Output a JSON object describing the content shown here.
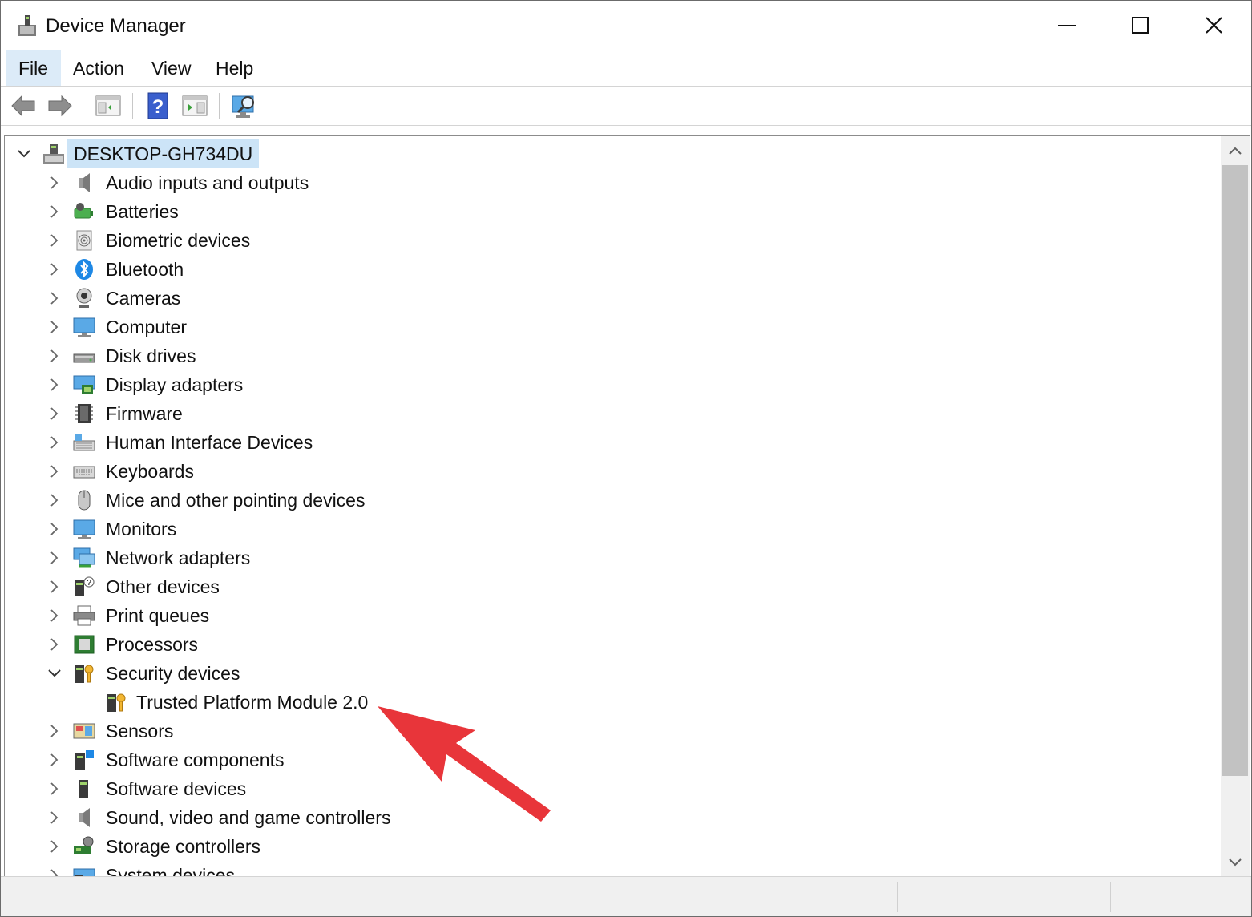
{
  "window": {
    "title": "Device Manager"
  },
  "menu": {
    "file": "File",
    "action": "Action",
    "view": "View",
    "help": "Help"
  },
  "toolbar": {
    "buttons": [
      "back-arrow-icon",
      "forward-arrow-icon",
      "show-hide-console-tree-icon",
      "help-icon",
      "action-pane-icon",
      "scan-hardware-changes-icon"
    ]
  },
  "tree": {
    "root": {
      "label": "DESKTOP-GH734DU",
      "icon": "computer-tower-icon",
      "expanded": true
    },
    "categories": [
      {
        "label": "Audio inputs and outputs",
        "icon": "speaker-icon",
        "expanded": false
      },
      {
        "label": "Batteries",
        "icon": "battery-icon",
        "expanded": false
      },
      {
        "label": "Biometric devices",
        "icon": "fingerprint-icon",
        "expanded": false
      },
      {
        "label": "Bluetooth",
        "icon": "bluetooth-icon",
        "expanded": false
      },
      {
        "label": "Cameras",
        "icon": "webcam-icon",
        "expanded": false
      },
      {
        "label": "Computer",
        "icon": "monitor-icon",
        "expanded": false
      },
      {
        "label": "Disk drives",
        "icon": "disk-drive-icon",
        "expanded": false
      },
      {
        "label": "Display adapters",
        "icon": "display-adapter-icon",
        "expanded": false
      },
      {
        "label": "Firmware",
        "icon": "chip-icon",
        "expanded": false
      },
      {
        "label": "Human Interface Devices",
        "icon": "hid-icon",
        "expanded": false
      },
      {
        "label": "Keyboards",
        "icon": "keyboard-icon",
        "expanded": false
      },
      {
        "label": "Mice and other pointing devices",
        "icon": "mouse-icon",
        "expanded": false
      },
      {
        "label": "Monitors",
        "icon": "monitor-icon",
        "expanded": false
      },
      {
        "label": "Network adapters",
        "icon": "network-icon",
        "expanded": false
      },
      {
        "label": "Other devices",
        "icon": "unknown-device-icon",
        "expanded": false
      },
      {
        "label": "Print queues",
        "icon": "printer-icon",
        "expanded": false
      },
      {
        "label": "Processors",
        "icon": "processor-icon",
        "expanded": false
      },
      {
        "label": "Security devices",
        "icon": "security-key-icon",
        "expanded": true,
        "children": [
          {
            "label": "Trusted Platform Module 2.0",
            "icon": "security-key-icon"
          }
        ]
      },
      {
        "label": "Sensors",
        "icon": "sensor-icon",
        "expanded": false
      },
      {
        "label": "Software components",
        "icon": "software-component-icon",
        "expanded": false
      },
      {
        "label": "Software devices",
        "icon": "software-device-icon",
        "expanded": false
      },
      {
        "label": "Sound, video and game controllers",
        "icon": "speaker-icon",
        "expanded": false
      },
      {
        "label": "Storage controllers",
        "icon": "storage-controller-icon",
        "expanded": false
      },
      {
        "label": "System devices",
        "icon": "system-device-icon",
        "expanded": false
      }
    ]
  },
  "colors": {
    "selection": "#cce4f7",
    "menu_active": "#dcebf8",
    "annotation_arrow": "#e8353a"
  }
}
